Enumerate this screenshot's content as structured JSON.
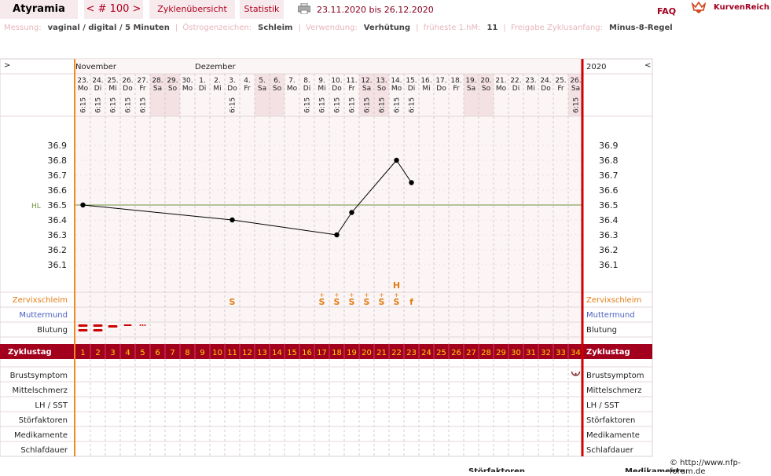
{
  "header": {
    "title": "Atyramia",
    "cycle_nav": "< # 100 >",
    "tab_overview": "Zyklenübersicht",
    "tab_stats": "Statistik",
    "date_range": "23.11.2020 bis 26.12.2020",
    "faq": "FAQ",
    "brand": "KurvenReich",
    "printer_icon": "printer-icon",
    "logo_icon": "crown-heart-icon"
  },
  "meta": [
    {
      "label": "Messung:",
      "value": "vaginal / digital / 5 Minuten"
    },
    {
      "label": "Östrogenzeichen:",
      "value": "Schleim"
    },
    {
      "label": "Verwendung:",
      "value": "Verhütung"
    },
    {
      "label": "früheste 1.hM:",
      "value": "11"
    },
    {
      "label": "Freigabe Zyklusanfang:",
      "value": "Minus-8-Regel"
    }
  ],
  "chart": {
    "nav_left": ">",
    "nav_right": "<",
    "year": "2020",
    "month_labels": [
      {
        "col": 1,
        "text": "November"
      },
      {
        "col": 9,
        "text": "Dezember"
      }
    ],
    "days": [
      {
        "n": "23.",
        "w": "Mo",
        "t": "6:15",
        "we": false
      },
      {
        "n": "24.",
        "w": "Di",
        "t": "6:15",
        "we": false
      },
      {
        "n": "25.",
        "w": "Mi",
        "t": "6:15",
        "we": false
      },
      {
        "n": "26.",
        "w": "Do",
        "t": "6:15",
        "we": false
      },
      {
        "n": "27.",
        "w": "Fr",
        "t": "6:15",
        "we": false
      },
      {
        "n": "28.",
        "w": "Sa",
        "t": "",
        "we": true
      },
      {
        "n": "29.",
        "w": "So",
        "t": "",
        "we": true
      },
      {
        "n": "30.",
        "w": "Mo",
        "t": "",
        "we": false
      },
      {
        "n": "1.",
        "w": "Di",
        "t": "",
        "we": false
      },
      {
        "n": "2.",
        "w": "Mi",
        "t": "",
        "we": false
      },
      {
        "n": "3.",
        "w": "Do",
        "t": "6:15",
        "we": false
      },
      {
        "n": "4.",
        "w": "Fr",
        "t": "",
        "we": false
      },
      {
        "n": "5.",
        "w": "Sa",
        "t": "",
        "we": true
      },
      {
        "n": "6.",
        "w": "So",
        "t": "",
        "we": true
      },
      {
        "n": "7.",
        "w": "Mo",
        "t": "",
        "we": false
      },
      {
        "n": "8.",
        "w": "Di",
        "t": "6:15",
        "we": false
      },
      {
        "n": "9.",
        "w": "Mi",
        "t": "6:15",
        "we": false
      },
      {
        "n": "10.",
        "w": "Do",
        "t": "6:15",
        "we": false
      },
      {
        "n": "11.",
        "w": "Fr",
        "t": "6:15",
        "we": false
      },
      {
        "n": "12.",
        "w": "Sa",
        "t": "6:15",
        "we": true
      },
      {
        "n": "13.",
        "w": "So",
        "t": "6:15",
        "we": true
      },
      {
        "n": "14.",
        "w": "Mo",
        "t": "6:15",
        "we": false
      },
      {
        "n": "15.",
        "w": "Di",
        "t": "6:15",
        "we": false
      },
      {
        "n": "16.",
        "w": "Mi",
        "t": "",
        "we": false
      },
      {
        "n": "17.",
        "w": "Do",
        "t": "",
        "we": false
      },
      {
        "n": "18.",
        "w": "Fr",
        "t": "",
        "we": false
      },
      {
        "n": "19.",
        "w": "Sa",
        "t": "",
        "we": true
      },
      {
        "n": "20.",
        "w": "So",
        "t": "",
        "we": true
      },
      {
        "n": "21.",
        "w": "Mo",
        "t": "",
        "we": false
      },
      {
        "n": "22.",
        "w": "Di",
        "t": "",
        "we": false
      },
      {
        "n": "23.",
        "w": "Mi",
        "t": "",
        "we": false
      },
      {
        "n": "24.",
        "w": "Do",
        "t": "",
        "we": false
      },
      {
        "n": "25.",
        "w": "Fr",
        "t": "",
        "we": false
      },
      {
        "n": "26.",
        "w": "Sa",
        "t": "6:15",
        "we": true
      }
    ],
    "y_ticks": [
      "36.9",
      "36.8",
      "36.7",
      "36.6",
      "36.5",
      "36.4",
      "36.3",
      "36.2",
      "36.1"
    ],
    "hl_label": "HL",
    "hl_value": 36.5,
    "rows_left": {
      "cervix": "Zervixschleim",
      "cervix_pos": "Muttermund",
      "bleeding": "Blutung",
      "cycle_day": "Zyklustag",
      "breast": "Brustsymptom",
      "mittel": "Mittelschmerz",
      "lh": "LH / SST",
      "stoer": "Störfaktoren",
      "med": "Medikamente",
      "sleep": "Schlafdauer"
    },
    "mucus": [
      {
        "day": 11,
        "sym": "S",
        "plus": false
      },
      {
        "day": 17,
        "sym": "S",
        "plus": true
      },
      {
        "day": 18,
        "sym": "S",
        "plus": true
      },
      {
        "day": 19,
        "sym": "S",
        "plus": true
      },
      {
        "day": 20,
        "sym": "S",
        "plus": true
      },
      {
        "day": 21,
        "sym": "S",
        "plus": true
      },
      {
        "day": 22,
        "sym": "S",
        "plus": true
      },
      {
        "day": 23,
        "sym": "f",
        "plus": false
      }
    ],
    "peak_marker": {
      "day": 22,
      "text": "H"
    },
    "bleeding": [
      {
        "day": 1,
        "level": "heavy"
      },
      {
        "day": 2,
        "level": "heavy"
      },
      {
        "day": 3,
        "level": "medium"
      },
      {
        "day": 4,
        "level": "light"
      },
      {
        "day": 5,
        "level": "spotting"
      }
    ],
    "breast_icon": {
      "day": 34,
      "name": "breast-symptom-icon"
    },
    "copyright": "© http://www.nfp-forum.de",
    "footer_fragments": [
      "Störfaktoren",
      "Medikamente"
    ]
  },
  "chart_data": {
    "type": "line",
    "title": "",
    "xlabel": "",
    "ylabel": "",
    "ylim": [
      36.0,
      37.0
    ],
    "series": [
      {
        "points": [
          [
            1,
            36.5
          ],
          [
            11,
            36.4
          ],
          [
            18,
            36.3
          ],
          [
            19,
            36.45
          ],
          [
            22,
            36.8
          ],
          [
            23,
            36.65
          ]
        ]
      }
    ],
    "colors": {
      "line": "#000000",
      "hl": "#6c8f3a",
      "cycle_start": "#f08a1f",
      "today": "#cc0000",
      "band": "#a3001e"
    }
  }
}
